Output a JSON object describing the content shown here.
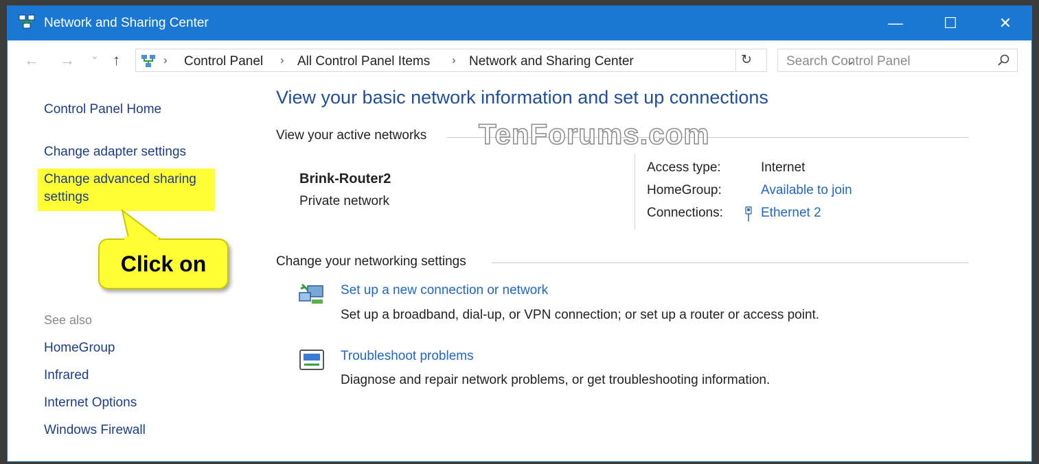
{
  "window": {
    "title": "Network and Sharing Center",
    "minimize_glyph": "—",
    "maximize_glyph": "☐",
    "close_glyph": "✕"
  },
  "address_bar": {
    "back_glyph": "←",
    "forward_glyph": "→",
    "recent_glyph": "⌄",
    "up_glyph": "↑",
    "breadcrumbs": [
      "Control Panel",
      "All Control Panel Items",
      "Network and Sharing Center"
    ],
    "separator": "›",
    "dropdown_glyph": "⌄",
    "refresh_glyph": "↻"
  },
  "search": {
    "placeholder": "Search Control Panel"
  },
  "sidebar": {
    "home": "Control Panel Home",
    "change_adapter": "Change adapter settings",
    "change_advanced_line1": "Change advanced sharing",
    "change_advanced_line2": "settings",
    "see_also": "See also",
    "see_also_items": [
      "HomeGroup",
      "Infrared",
      "Internet Options",
      "Windows Firewall"
    ]
  },
  "callout": {
    "text": "Click on"
  },
  "main": {
    "title": "View your basic network information and set up connections",
    "active_networks_label": "View your active networks",
    "watermark": "TenForums.com",
    "network": {
      "name": "Brink-Router2",
      "type": "Private network",
      "access_type_label": "Access type:",
      "access_type_value": "Internet",
      "homegroup_label": "HomeGroup:",
      "homegroup_value": "Available to join",
      "connections_label": "Connections:",
      "connections_value": "Ethernet 2"
    },
    "change_settings_label": "Change your networking settings",
    "tasks": [
      {
        "link": "Set up a new connection or network",
        "description": "Set up a broadband, dial-up, or VPN connection; or set up a router or access point."
      },
      {
        "link": "Troubleshoot problems",
        "description": "Diagnose and repair network problems, or get troubleshooting information."
      }
    ]
  },
  "colors": {
    "titlebar": "#1a78d4",
    "link": "#1f66c8",
    "highlight": "#ffff33"
  }
}
